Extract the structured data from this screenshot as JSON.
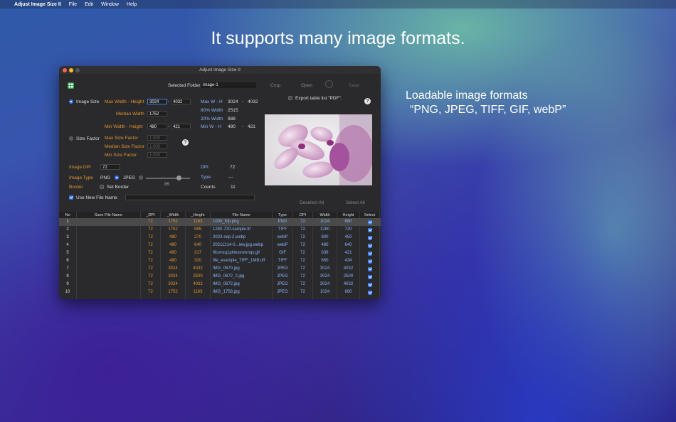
{
  "menubar": {
    "app": "Adjust Image Size II",
    "items": [
      "File",
      "Edit",
      "Window",
      "Help"
    ]
  },
  "headline": "It supports many image formats.",
  "side_text": {
    "line1": "Loadable image formats",
    "line2": "“PNG, JPEG, TIFF, GIF, webP”"
  },
  "window": {
    "title": "Adjust Image Size II",
    "selected_folder_label": "Selected Folder",
    "selected_folder_value": "image-1",
    "crop": "Crop",
    "open": "Open",
    "save": "Save",
    "export_pdf": "Export table list \"PDF\".",
    "image_size": "Image Size",
    "max_wh_label": "Max Width - Height",
    "max_w": "3024",
    "max_h": "4032",
    "median_width_label": "Median Width",
    "median_width": "1752",
    "min_wh_label": "Min Width - Height",
    "min_w": "480",
    "min_h": "421",
    "dash": "-",
    "info": {
      "max_label": "Max W - H",
      "max_w": "3024",
      "max_h": "4032",
      "w80_label": "80% Width",
      "w80": "2515",
      "w20_label": "20% Width",
      "w20": "988",
      "min_label": "Min W - H",
      "min_w": "480",
      "min_h": "421"
    },
    "size_factor": "Size Factor",
    "max_sf_label": "Max Size Factor",
    "max_sf": "1.000",
    "median_sf_label": "Median Size Factor",
    "median_sf": "1.000",
    "min_sf_label": "Min Size Factor",
    "min_sf": "1.000",
    "image_dpi_label": "Image DPI",
    "image_dpi": "72",
    "image_type_label": "Image Type",
    "png": "PNG",
    "jpeg": "JPEG",
    "quality": "85",
    "border_label": "Border",
    "set_border": "Set Border",
    "use_new_name": "Use New File Name",
    "dpi_label": "DPI",
    "dpi_value": "72",
    "type_label": "Type",
    "type_value": "---",
    "counts_label": "Counts",
    "counts_value": "11",
    "deselect_all": "Deselect All",
    "select_all": "Select All",
    "help": "?"
  },
  "table": {
    "headers": [
      "No",
      "Save File Name",
      "_DPI",
      "_Width",
      "_Height",
      "File Name",
      "Type",
      "DPI",
      "Width",
      "Height",
      "Select"
    ],
    "rows": [
      {
        "no": "1",
        "dpi_o": "72",
        "w_o": "1752",
        "h_o": "1163",
        "file": "1000_frip.png",
        "type": "PNG",
        "dpi": "72",
        "w": "1024",
        "h": "680"
      },
      {
        "no": "2",
        "dpi_o": "72",
        "w_o": "1752",
        "h_o": "985",
        "file": "1280-720-sample.tif",
        "type": "TIFF",
        "dpi": "72",
        "w": "1280",
        "h": "720"
      },
      {
        "no": "3",
        "dpi_o": "72",
        "w_o": "480",
        "h_o": "270",
        "file": "2023-sep-2.webp",
        "type": "webP",
        "dpi": "72",
        "w": "800",
        "h": "450"
      },
      {
        "no": "4",
        "dpi_o": "72",
        "w_o": "480",
        "h_o": "640",
        "file": "20211214-0...iew.jpg.webp",
        "type": "webP",
        "dpi": "72",
        "w": "480",
        "h": "640"
      },
      {
        "no": "5",
        "dpi_o": "72",
        "w_o": "480",
        "h_o": "317",
        "file": "filcvnsq1plnkovuvmqv.gif",
        "type": "GIF",
        "dpi": "72",
        "w": "636",
        "h": "421"
      },
      {
        "no": "6",
        "dpi_o": "72",
        "w_o": "480",
        "h_o": "320",
        "file": "file_example_TIFF_1MB.tiff",
        "type": "TIFF",
        "dpi": "72",
        "w": "650",
        "h": "434"
      },
      {
        "no": "7",
        "dpi_o": "72",
        "w_o": "3024",
        "h_o": "4032",
        "file": "IMG_0670.jpg",
        "type": "JPEG",
        "dpi": "72",
        "w": "3024",
        "h": "4032"
      },
      {
        "no": "8",
        "dpi_o": "72",
        "w_o": "3024",
        "h_o": "2500",
        "file": "IMG_0672_2.jpg",
        "type": "JPEG",
        "dpi": "72",
        "w": "3024",
        "h": "2500"
      },
      {
        "no": "9",
        "dpi_o": "72",
        "w_o": "3024",
        "h_o": "4032",
        "file": "IMG_0672.jpg",
        "type": "JPEG",
        "dpi": "72",
        "w": "3024",
        "h": "4032"
      },
      {
        "no": "10",
        "dpi_o": "72",
        "w_o": "1752",
        "h_o": "1163",
        "file": "IMG_1758.jpg",
        "type": "JPEG",
        "dpi": "72",
        "w": "1024",
        "h": "680"
      }
    ]
  },
  "colors": {
    "accent": "#3478f6",
    "orange": "#e0952c",
    "blue_text": "#8ab4f8"
  }
}
